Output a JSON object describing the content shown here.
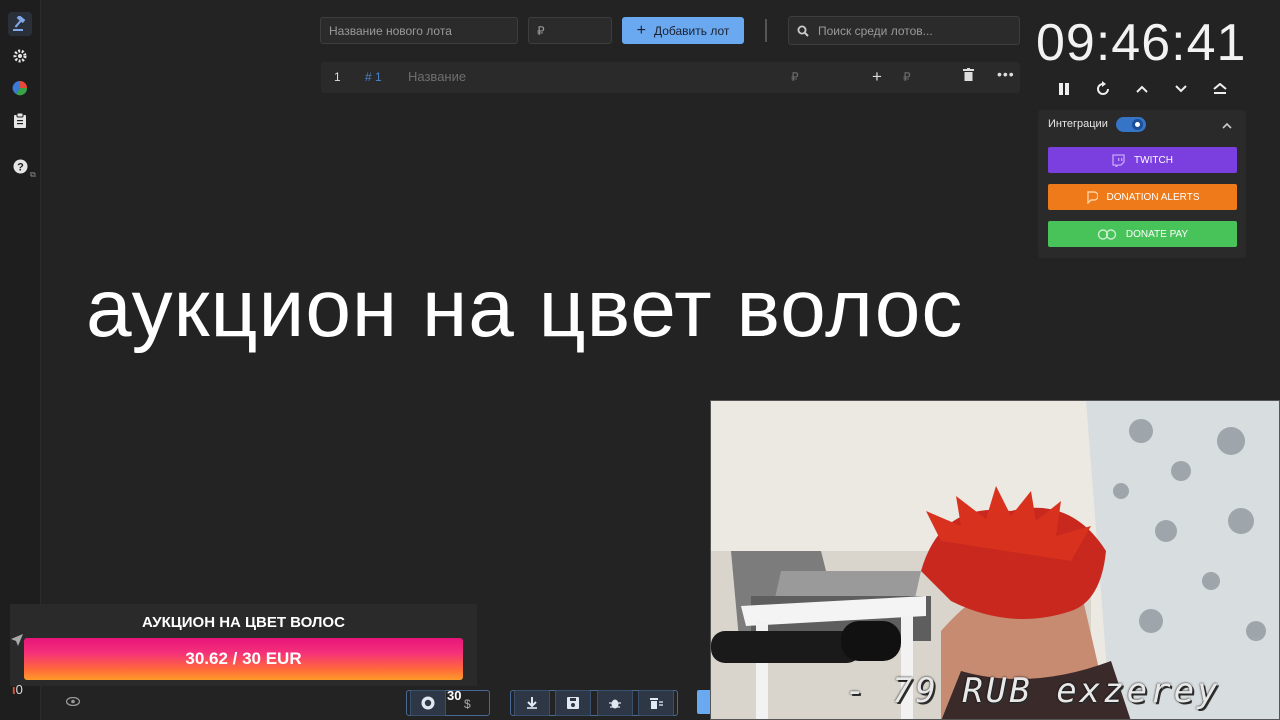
{
  "sidebar": {
    "items": [
      {
        "icon": "gavel-icon",
        "active": true
      },
      {
        "icon": "gear-icon"
      },
      {
        "icon": "pie-chart-icon"
      },
      {
        "icon": "clipboard-icon"
      },
      {
        "icon": "help-icon"
      }
    ]
  },
  "lot_form": {
    "name_placeholder": "Название нового лота",
    "amount_placeholder": "₽",
    "add_label": "Добавить лот"
  },
  "search": {
    "placeholder": "Поиск среди лотов..."
  },
  "lots": [
    {
      "index": "1",
      "id": "# 1",
      "name_placeholder": "Название",
      "currency": "₽",
      "add_currency": "₽"
    }
  ],
  "timer": {
    "time": "09:46:41"
  },
  "integrations": {
    "title": "Интеграции",
    "enabled": true,
    "buttons": [
      {
        "label": "TWITCH",
        "color": "#7b3fe0",
        "icon": "twitch-icon"
      },
      {
        "label": "DONATION ALERTS",
        "color": "#ef7a1a",
        "icon": "donationalerts-icon"
      },
      {
        "label": "DONATE PAY",
        "color": "#48c35a",
        "icon": "donatepay-icon"
      }
    ]
  },
  "overlay_text": "аукцион на цвет волос",
  "webcam": {
    "overlay": "- 79 RUB   exzerey"
  },
  "goal": {
    "title": "АУКЦИОН НА ЦВЕТ ВОЛОС",
    "progress_text": "30.62 / 30 EUR",
    "progress": 1.0
  },
  "footer": {
    "counter": "0",
    "participants": "30",
    "currency_symbol": "$"
  }
}
